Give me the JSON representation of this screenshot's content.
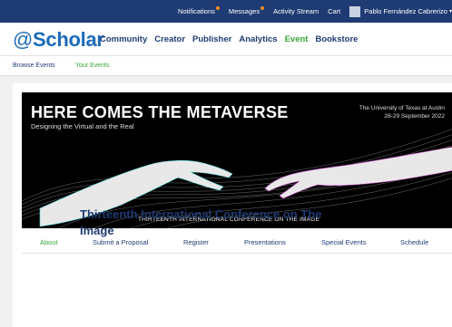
{
  "topbar": {
    "notifications": "Notifications",
    "messages": "Messages",
    "activity_stream": "Activity Stream",
    "cart": "Cart",
    "user_name": "Pablo Fernández Cabrerizo",
    "dot_color": "#f28b1e"
  },
  "logo": {
    "at": "@",
    "name": "Scholar"
  },
  "nav": {
    "community": "Community",
    "creator": "Creator",
    "publisher": "Publisher",
    "analytics": "Analytics",
    "event": "Event",
    "bookstore": "Bookstore"
  },
  "subnav": {
    "browse_events": "Browse Events",
    "your_events": "Your Events"
  },
  "banner": {
    "title": "HERE COMES THE METAVERSE",
    "subtitle": "Designing the Virtual and the Real",
    "venue": "The University of Texas at Austin",
    "dates": "28-29 September 2022",
    "conference": "THIRTEENTH INTERNATIONAL CONFERENCE ON THE IMAGE"
  },
  "event_nav": {
    "about": "About",
    "submit": "Submit a Proposal",
    "register": "Register",
    "presentations": "Presentations",
    "special_events": "Special Events",
    "schedule": "Schedule"
  },
  "page": {
    "title": "Thirteenth International Conference on The Image"
  },
  "colors": {
    "navy": "#1f3b73",
    "accent_green": "#37a437",
    "logo_blue": "#1b6bb8"
  }
}
